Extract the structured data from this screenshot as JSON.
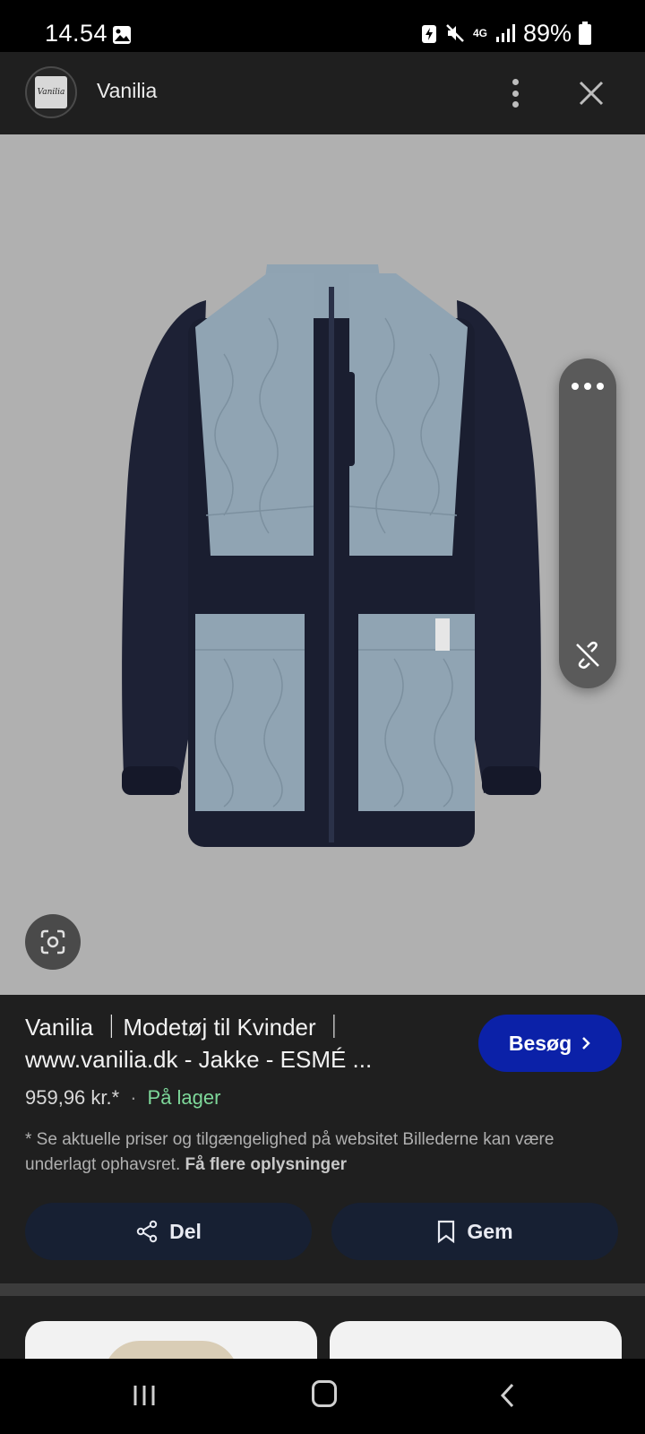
{
  "status_bar": {
    "time": "14.54",
    "network": "4G",
    "battery": "89%"
  },
  "header": {
    "site_name": "Vanilia",
    "logo_text": "Vanilia"
  },
  "result": {
    "title": "Vanilia ｜Modetøj til Kvinder ｜ www.vanilia.dk - Jakke - ESMÉ ...",
    "visit_label": "Besøg",
    "price": "959,96 kr.*",
    "separator": "·",
    "stock": "På lager",
    "disclaimer": "* Se aktuelle priser og tilgængelighed på websitet Billederne kan være underlagt ophavsret.",
    "more_info": "Få flere oplysninger",
    "share_label": "Del",
    "save_label": "Gem"
  },
  "colors": {
    "visit_button": "#0b21a8",
    "stock_green": "#7ed89a",
    "action_button": "#172033"
  },
  "icons": [
    "gallery-icon",
    "more-vert-icon",
    "close-icon",
    "lens-icon",
    "ellipsis-icon",
    "link-off-icon",
    "chevron-right-icon",
    "share-icon",
    "bookmark-icon"
  ]
}
